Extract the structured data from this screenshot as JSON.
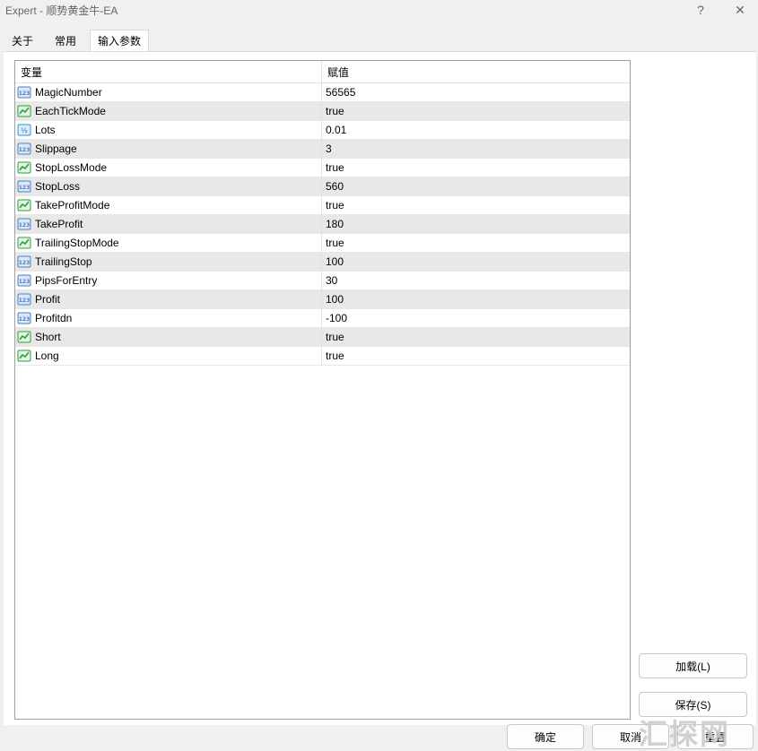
{
  "window": {
    "title": "Expert - 顺势黄金牛-EA",
    "help_label": "?",
    "close_label": "✕"
  },
  "tabs": [
    {
      "label": "关于"
    },
    {
      "label": "常用"
    },
    {
      "label": "输入参数"
    }
  ],
  "grid": {
    "header_variable": "变量",
    "header_value": "赋值",
    "rows": [
      {
        "name": "MagicNumber",
        "value": "56565",
        "icon": "integer-icon"
      },
      {
        "name": "EachTickMode",
        "value": "true",
        "icon": "bool-icon"
      },
      {
        "name": "Lots",
        "value": "0.01",
        "icon": "double-icon"
      },
      {
        "name": "Slippage",
        "value": "3",
        "icon": "integer-icon"
      },
      {
        "name": "StopLossMode",
        "value": "true",
        "icon": "bool-icon"
      },
      {
        "name": "StopLoss",
        "value": "560",
        "icon": "integer-icon"
      },
      {
        "name": "TakeProfitMode",
        "value": "true",
        "icon": "bool-icon"
      },
      {
        "name": "TakeProfit",
        "value": "180",
        "icon": "integer-icon"
      },
      {
        "name": "TrailingStopMode",
        "value": "true",
        "icon": "bool-icon"
      },
      {
        "name": "TrailingStop",
        "value": "100",
        "icon": "integer-icon"
      },
      {
        "name": "PipsForEntry",
        "value": "30",
        "icon": "integer-icon"
      },
      {
        "name": "Profit",
        "value": "100",
        "icon": "integer-icon"
      },
      {
        "name": "Profitdn",
        "value": "-100",
        "icon": "integer-icon"
      },
      {
        "name": "Short",
        "value": "true",
        "icon": "bool-icon"
      },
      {
        "name": "Long",
        "value": "true",
        "icon": "bool-icon"
      }
    ]
  },
  "buttons": {
    "load": "加载(L)",
    "save": "保存(S)",
    "ok": "确定",
    "cancel": "取消",
    "reset": "重置"
  },
  "watermark": "汇探网",
  "colors": {
    "integer_icon": "#4a7fc0",
    "bool_icon": "#2e9e3e",
    "double_icon": "#3a8fd0"
  }
}
